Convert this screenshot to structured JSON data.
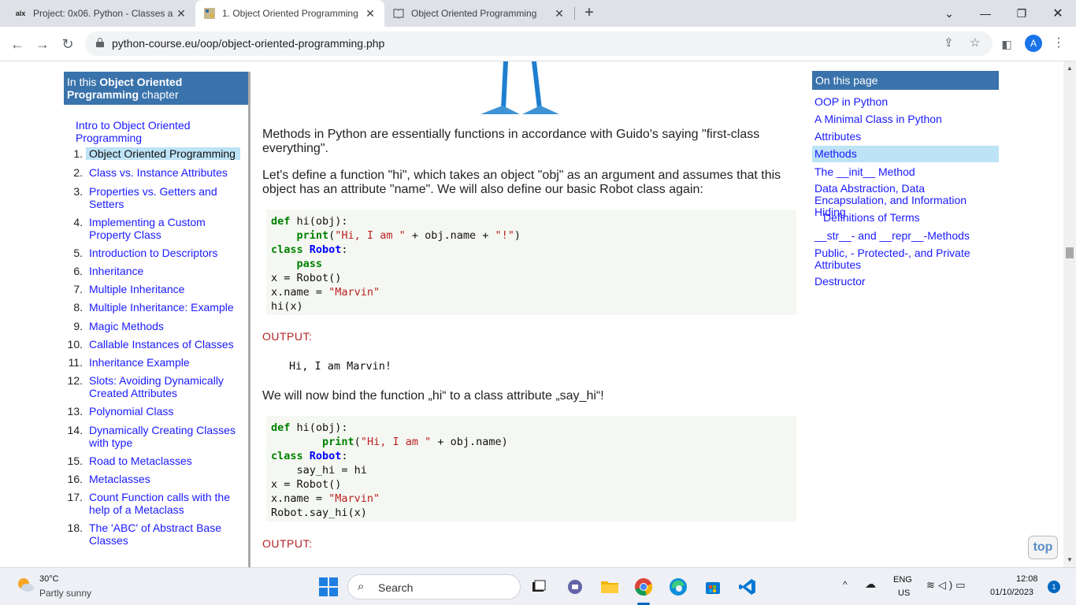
{
  "browser": {
    "tabs": [
      {
        "title": "Project: 0x06. Python - Classes a",
        "favicon": "alx"
      },
      {
        "title": "1. Object Oriented Programming",
        "favicon": "python-course-icon"
      },
      {
        "title": "Object Oriented Programming",
        "favicon": "book-icon"
      }
    ],
    "url": "python-course.eu/oop/object-oriented-programming.php",
    "avatar_letter": "A"
  },
  "left_nav": {
    "heading_prefix": "In this ",
    "heading_bold": "Object Oriented Programming",
    "heading_suffix": " chapter",
    "intro_link": "Intro to Object Oriented Programming",
    "items": [
      {
        "num": "1.",
        "label": "Object Oriented Programming"
      },
      {
        "num": "2.",
        "label": "Class vs. Instance Attributes"
      },
      {
        "num": "3.",
        "label": "Properties vs. Getters and Setters"
      },
      {
        "num": "4.",
        "label": "Implementing a Custom Property Class"
      },
      {
        "num": "5.",
        "label": "Introduction to Descriptors"
      },
      {
        "num": "6.",
        "label": "Inheritance"
      },
      {
        "num": "7.",
        "label": "Multiple Inheritance"
      },
      {
        "num": "8.",
        "label": "Multiple Inheritance: Example"
      },
      {
        "num": "9.",
        "label": "Magic Methods"
      },
      {
        "num": "10.",
        "label": "Callable Instances of Classes"
      },
      {
        "num": "11.",
        "label": "Inheritance Example"
      },
      {
        "num": "12.",
        "label": "Slots: Avoiding Dynamically Created Attributes"
      },
      {
        "num": "13.",
        "label": "Polynomial Class"
      },
      {
        "num": "14.",
        "label": "Dynamically Creating Classes with type"
      },
      {
        "num": "15.",
        "label": "Road to Metaclasses"
      },
      {
        "num": "16.",
        "label": "Metaclasses"
      },
      {
        "num": "17.",
        "label": "Count Function calls with the help of a Metaclass"
      },
      {
        "num": "18.",
        "label": "The 'ABC' of Abstract Base Classes"
      }
    ]
  },
  "main": {
    "para1": "Methods in Python are essentially functions in accordance with Guido's saying \"first-class everything\".",
    "para2": "Let's define a function \"hi\", which takes an object \"obj\" as an argument and assumes that this object has an attribute \"name\". We will also define our basic Robot class again:",
    "code1": {
      "l1_kw": "def",
      "l1_rest": " hi(obj):",
      "l2_indent": "    ",
      "l2_fn": "print",
      "l2_open": "(",
      "l2_str1": "\"Hi, I am \"",
      "l2_mid": " + obj.name + ",
      "l2_str2": "\"!\"",
      "l2_close": ")",
      "l3_kw": "class",
      "l3_sp": " ",
      "l3_cls": "Robot",
      "l3_colon": ":",
      "l4_indent": "    ",
      "l4_kw": "pass",
      "l5": "x = Robot()",
      "l6_pre": "x.name = ",
      "l6_str": "\"Marvin\"",
      "l7": "hi(x)"
    },
    "output_label": "OUTPUT:",
    "output1": "Hi, I am Marvin!",
    "para3": "We will now bind the function „hi“ to a class attribute „say_hi“!",
    "code2": {
      "l1_kw": "def",
      "l1_rest": " hi(obj):",
      "l2_indent": "        ",
      "l2_fn": "print",
      "l2_open": "(",
      "l2_str1": "\"Hi, I am \"",
      "l2_rest": " + obj.name)",
      "l3_kw": "class",
      "l3_sp": " ",
      "l3_cls": "Robot",
      "l3_colon": ":",
      "l4": "    say_hi = hi",
      "l5": "x = Robot()",
      "l6_pre": "x.name = ",
      "l6_str": "\"Marvin\"",
      "l7": "Robot.say_hi(x)"
    },
    "output_label2": "OUTPUT:"
  },
  "right_nav": {
    "heading": "On this page",
    "items": [
      "OOP in Python",
      "A Minimal Class in Python",
      "Attributes",
      "Methods",
      "The __init__ Method",
      "Data Abstraction, Data Encapsulation, and Information Hiding",
      "Definitions of Terms",
      "__str__- and __repr__-Methods",
      "Public, - Protected-, and Private Attributes",
      "Destructor"
    ]
  },
  "top_button": "top",
  "taskbar": {
    "temperature": "30°C",
    "weather": "Partly sunny",
    "search": "Search",
    "lang_line1": "ENG",
    "lang_line2": "US",
    "time": "12:08",
    "date": "01/10/2023",
    "notification_count": "1"
  }
}
